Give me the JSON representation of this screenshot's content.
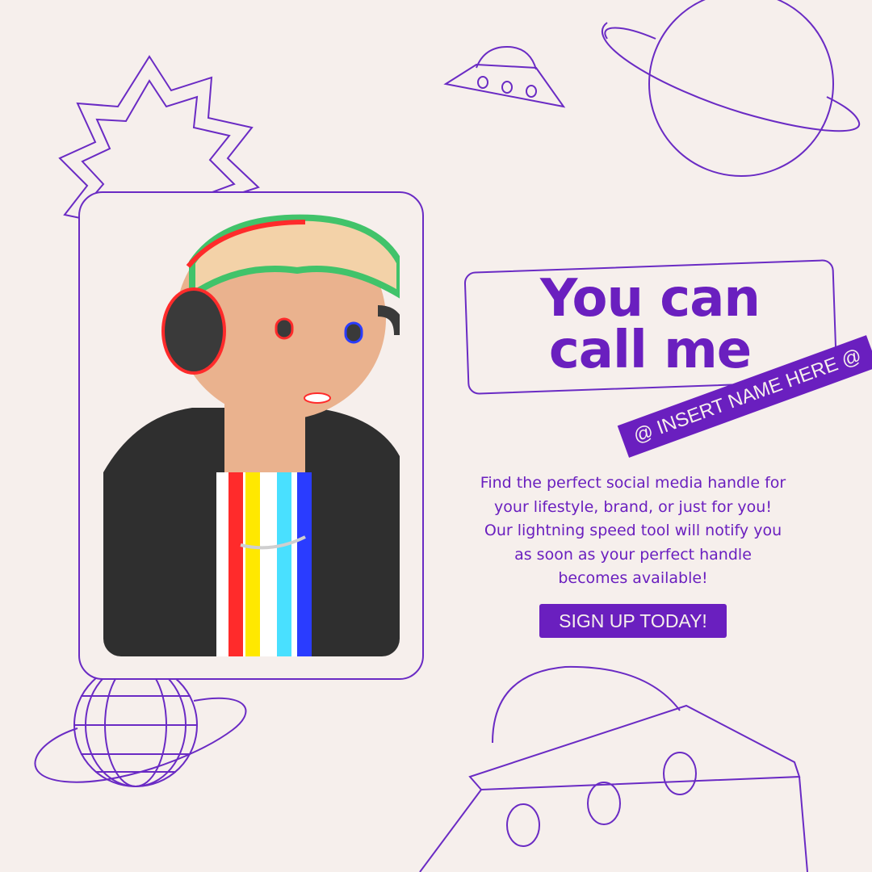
{
  "title": {
    "line1": "You can",
    "line2": "call me"
  },
  "handle_tag": "@ INSERT NAME HERE @",
  "description": "Find the perfect social media handle for your lifestyle, brand, or just for you! Our lightning speed tool will notify you as soon as your perfect handle becomes available!",
  "cta_label": "SIGN UP TODAY!",
  "colors": {
    "accent": "#6a1fbf",
    "background": "#f6efec",
    "line": "#6a2bc4"
  },
  "icons": [
    "starburst-icon",
    "ufo-icon",
    "planet-icon",
    "disco-planet-icon"
  ]
}
